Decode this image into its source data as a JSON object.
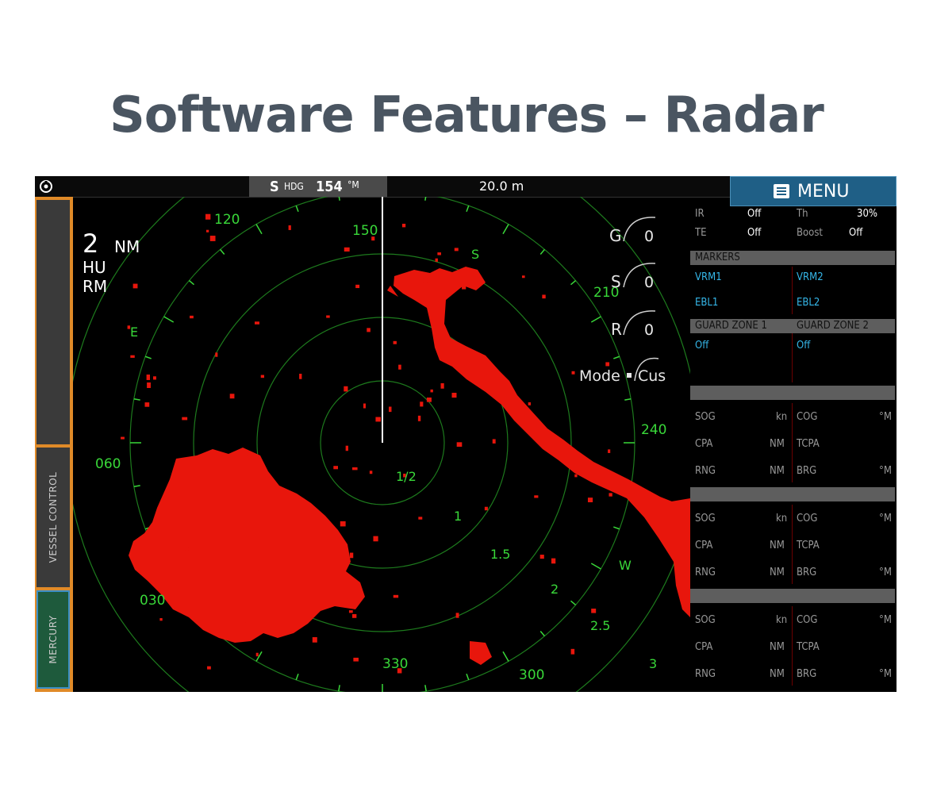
{
  "page": {
    "title": "Software Features – Radar"
  },
  "topbar": {
    "heading_ref": "S",
    "heading_label": "HDG",
    "heading_value": "154",
    "heading_unit": "°M",
    "range_value": "20.0 m"
  },
  "menu": {
    "label": "MENU"
  },
  "sidebar": {
    "tabs": [
      {
        "label": ""
      },
      {
        "label": "VESSEL CONTROL"
      },
      {
        "label": "MERCURY"
      }
    ]
  },
  "radar": {
    "range_value": "2",
    "range_unit": "NM",
    "orientation": "HU",
    "motion": "RM",
    "cardinals": {
      "south": "S",
      "east": "E",
      "west": "W"
    },
    "bearing_labels": [
      "120",
      "150",
      "210",
      "240",
      "060",
      "030",
      "330",
      "300"
    ],
    "ring_labels": [
      "1/2",
      "1",
      "1.5",
      "2",
      "2.5",
      "3"
    ],
    "controls": [
      {
        "letter": "G",
        "value": "0"
      },
      {
        "letter": "S",
        "value": "0"
      },
      {
        "letter": "R",
        "value": "0"
      }
    ],
    "mode_label": "Mode",
    "mode_value": "Cus",
    "colors": {
      "target": "#e8160c",
      "ring": "#1d7a1d",
      "label": "#39d839"
    }
  },
  "panel": {
    "ir_label": "IR",
    "ir_value": "Off",
    "th_label": "Th",
    "th_value": "30%",
    "te_label": "TE",
    "te_value": "Off",
    "boost_label": "Boost",
    "boost_value": "Off",
    "markers_header": "MARKERS",
    "vrm1": "VRM1",
    "vrm2": "VRM2",
    "ebl1": "EBL1",
    "ebl2": "EBL2",
    "guard1_header": "GUARD ZONE 1",
    "guard2_header": "GUARD ZONE 2",
    "guard1_value": "Off",
    "guard2_value": "Off",
    "targets": [
      {
        "sog": "SOG",
        "sog_unit": "kn",
        "cog": "COG",
        "cog_unit": "°M",
        "cpa": "CPA",
        "cpa_unit": "NM",
        "tcpa": "TCPA",
        "rng": "RNG",
        "rng_unit": "NM",
        "brg": "BRG",
        "brg_unit": "°M"
      },
      {
        "sog": "SOG",
        "sog_unit": "kn",
        "cog": "COG",
        "cog_unit": "°M",
        "cpa": "CPA",
        "cpa_unit": "NM",
        "tcpa": "TCPA",
        "rng": "RNG",
        "rng_unit": "NM",
        "brg": "BRG",
        "brg_unit": "°M"
      },
      {
        "sog": "SOG",
        "sog_unit": "kn",
        "cog": "COG",
        "cog_unit": "°M",
        "cpa": "CPA",
        "cpa_unit": "NM",
        "tcpa": "TCPA",
        "rng": "RNG",
        "rng_unit": "NM",
        "brg": "BRG",
        "brg_unit": "°M"
      }
    ]
  }
}
